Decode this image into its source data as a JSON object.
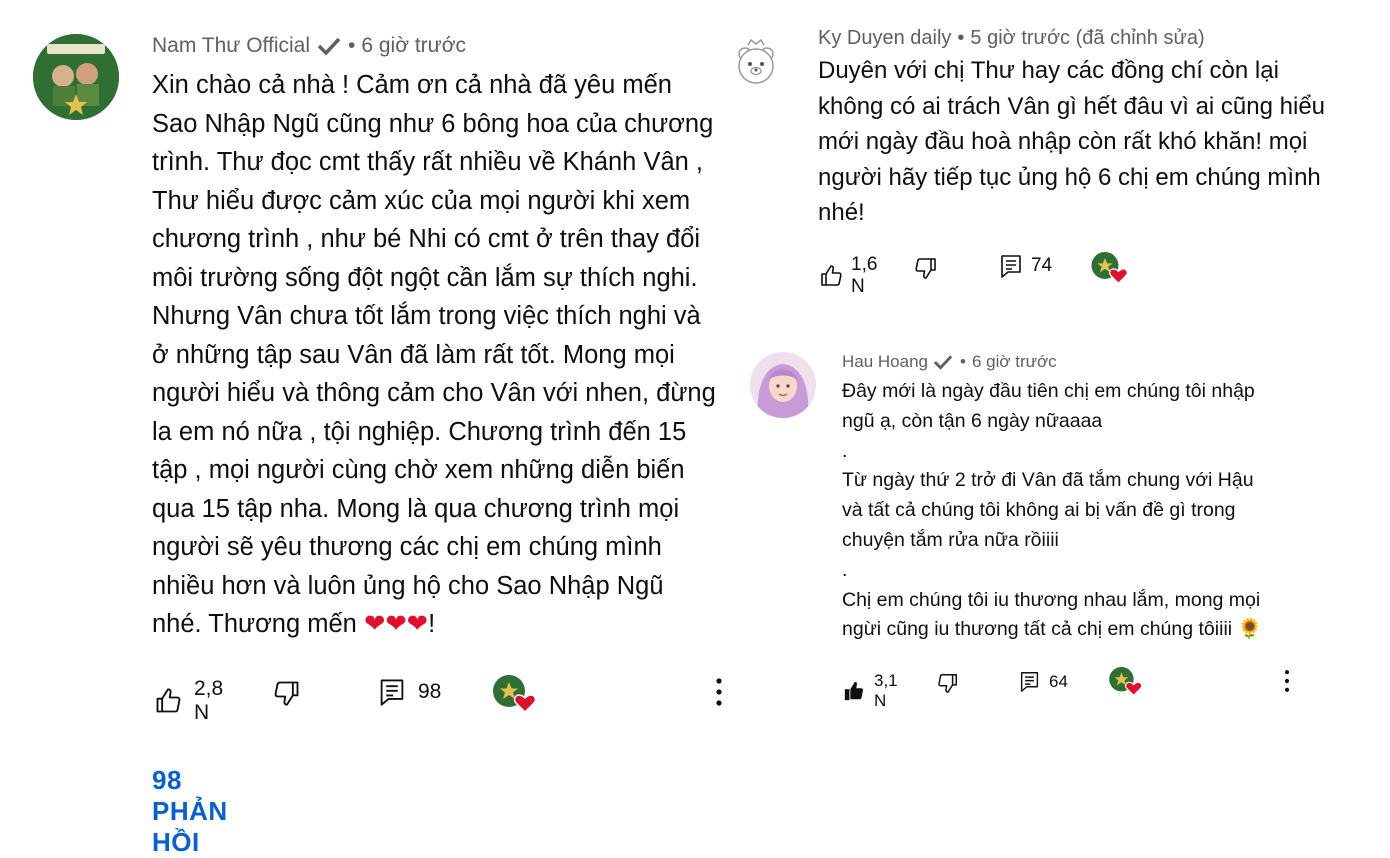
{
  "comments": [
    {
      "author": "Nam Thư Official",
      "time": "6 giờ trước",
      "text": "Xin chào cả nhà ! Cảm ơn cả nhà đã yêu mến\nSao Nhập Ngũ cũng như 6 bông hoa của chương\ntrình. Thư đọc cmt thấy rất nhiều về Khánh Vân ,\nThư hiểu được cảm xúc của mọi người khi xem\nchương trình , như bé Nhi có cmt ở trên  thay đổi\nmôi trường sống đột ngột cần lắm sự thích nghi.\nNhưng Vân chưa tốt lắm trong việc thích nghi và\nở những tập sau Vân đã làm rất tốt. Mong mọi\nngười hiểu và thông cảm cho Vân với nhen, đừng\nla em nó nữa , tội nghiệp. Chương trình đến 15\ntập , mọi người cùng chờ xem những diễn biến\nqua 15 tập nha. Mong là qua chương trình mọi\nngười sẽ yêu thương các chị em chúng mình\nnhiều hơn và luôn ủng hộ cho Sao Nhập Ngũ\nnhé. Thương mến ",
      "text_end": "!",
      "hearts": "❤❤❤",
      "likes": "2,8 N",
      "replies_count": "98",
      "replies_link": "98 PHẢN HỒI"
    },
    {
      "author": "Ky Duyen daily",
      "time": "5 giờ trước (đã chỉnh sửa)",
      "text": "Duyên với chị Thư hay các đồng chí còn lại\nkhông có ai trách Vân gì hết đâu vì ai cũng hiểu\nmới ngày đầu hoà nhập còn rất khó khăn! mọi\nngười  hãy tiếp tục ủng hộ 6 chị em chúng mình\nnhé!",
      "likes": "1,6 N",
      "replies_count": "74"
    },
    {
      "author": "Hau Hoang",
      "time": "6 giờ trước",
      "text": "Đây mới là ngày đầu tiên chị em chúng tôi nhập\nngũ ạ, còn tận 6 ngày nữaaaa\n.\nTừ ngày thứ 2 trở đi Vân đã tắm chung với Hậu\nvà tất cả chúng tôi không ai bị vấn đề gì trong\nchuyện tắm rửa nữa rồiiii\n.\nChị em chúng tôi iu thương nhau lắm, mong mọi\nngừi cũng iu thương tất cả chị em chúng tôiiii ",
      "emoji": "🌻",
      "likes": "3,1 N",
      "replies_count": "64"
    }
  ],
  "colors": {
    "meta": "#606060",
    "link": "#065fd4",
    "heart": "#e0102a",
    "channel_green": "#2e6b2e"
  },
  "icons": [
    "verified-icon",
    "like-icon",
    "dislike-icon",
    "reply-icon",
    "creator-heart-icon",
    "more-icon",
    "bear-avatar-icon"
  ]
}
